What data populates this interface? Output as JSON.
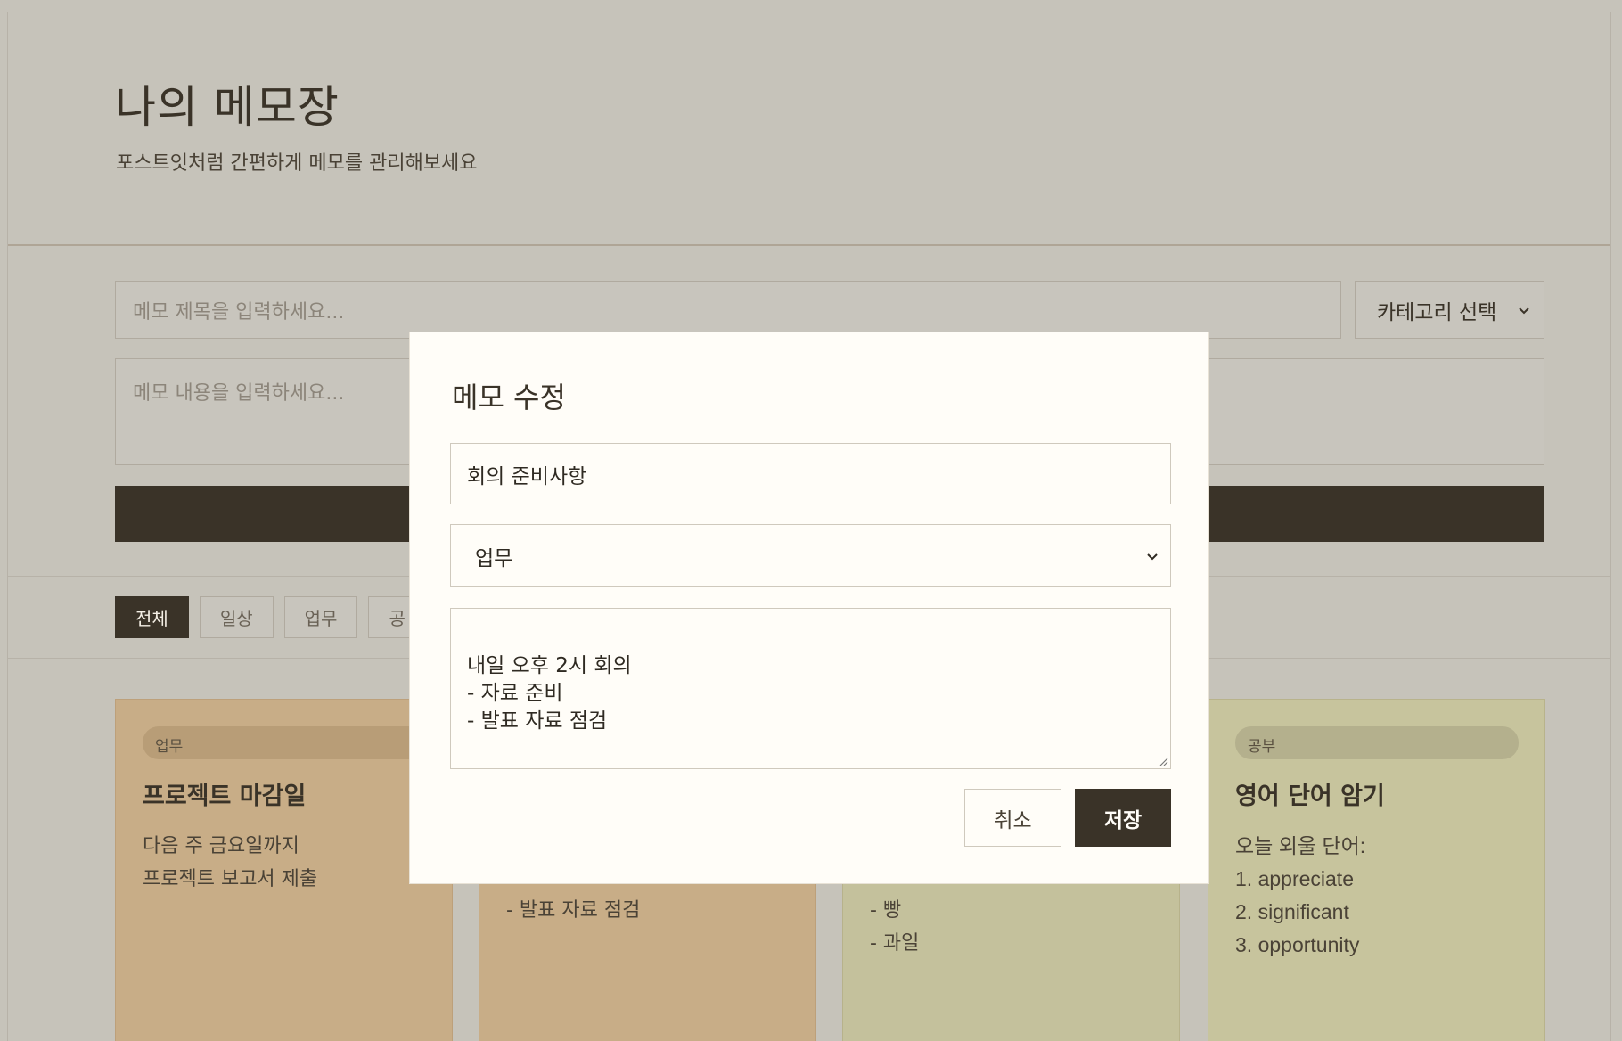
{
  "app": {
    "title": "나의 메모장",
    "subtitle": "포스트잇처럼 간편하게 메모를 관리해보세요"
  },
  "form": {
    "title_placeholder": "메모 제목을 입력하세요...",
    "category_label": "카테고리 선택",
    "content_placeholder": "메모 내용을 입력하세요..."
  },
  "filters": [
    {
      "label": "전체",
      "active": true
    },
    {
      "label": "일상",
      "active": false
    },
    {
      "label": "업무",
      "active": false
    },
    {
      "label": "공",
      "active": false
    }
  ],
  "cards": [
    {
      "tag": "업무",
      "title": "프로젝트 마감일",
      "body": "다음 주 금요일까지\n프로젝트 보고서 제출"
    },
    {
      "tag": "",
      "title": "",
      "body": "- 발표 자료 점검"
    },
    {
      "tag": "",
      "title": "",
      "body": "- 빵\n- 과일"
    },
    {
      "tag": "공부",
      "title": "영어 단어 암기",
      "body": "오늘 외울 단어:\n1. appreciate\n2. significant\n3. opportunity"
    }
  ],
  "modal": {
    "title": "메모 수정",
    "memo_title": "회의 준비사항",
    "category": "업무",
    "content": "내일 오후 2시 회의\n- 자료 준비\n- 발표 자료 점검",
    "cancel_label": "취소",
    "save_label": "저장"
  },
  "colors": {
    "backdrop": "#c6c3ba",
    "accent_dark": "#3a3328",
    "modal_bg": "#fffdf8",
    "card_work": "#c8ad87",
    "card_study": "#c7c49d"
  }
}
